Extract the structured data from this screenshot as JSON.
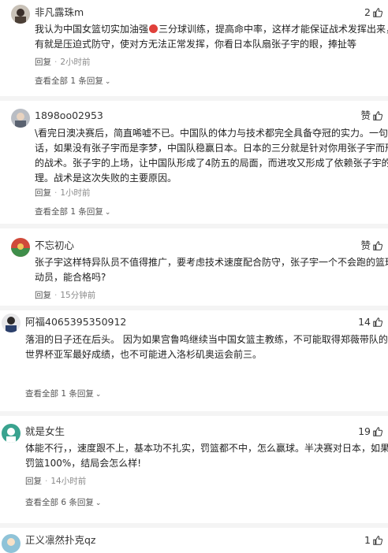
{
  "ui": {
    "reply_label": "回复",
    "dot": "·"
  },
  "comments": [
    {
      "username": "非凡露珠m",
      "likes": "2",
      "lines": [
        "我认为中国女篮切实加油强",
        "三分球训练，提高命中率，这样才能保证战术发挥出来，再",
        "有就是压迫式防守，使对方无法正常发挥，你看日本队扇张子宇的眼，捧扯等"
      ],
      "time": "2小时前",
      "view_replies": "查看全部 1 条回复"
    },
    {
      "username": "1898oo02953",
      "likes": "赞",
      "lines": [
        "\\看完日澳决赛后，简直唏嘘不已。中国队的体力与技术都完全具备夺冠的实力。一句",
        "话，如果没有张子宇而是李梦，中国队稳赢日本。日本的三分就是针对你用张子宇而形成",
        "的战术。张子宇的上场，让中国队形成了4防五的局面，而进攻又形成了依赖张子宇的心",
        "理。战术是这次失败的主要原因。"
      ],
      "time": "1小时前",
      "view_replies": "查看全部 1 条回复"
    },
    {
      "username": "不忘初心",
      "likes": "赞",
      "lines": [
        "张子宇这样特异队员不值得推广，要考虑技术速度配合防守，张子宇一个不会跑的篮球运",
        "动员，能合格吗?"
      ],
      "time": "15分钟前",
      "view_replies": ""
    },
    {
      "username": "阿福4065395350912",
      "likes": "14",
      "lines": [
        "落泪的日子还在后头。 因为如果宫鲁鸣继续当中国女篮主教练，不可能取得郑薇带队的",
        "世界杯亚军最好成绩，也不可能进入洛杉矶奥运会前三。"
      ],
      "time": "",
      "view_replies": "查看全部 1 条回复"
    },
    {
      "username": "就是女生",
      "likes": "19",
      "lines": [
        "体能不行，，速度跟不上，基本功不扎实，罚篮都不中，怎么赢球。半决赛对日本，如果",
        "罚篮100%，结局会怎么样!"
      ],
      "time": "14小时前",
      "view_replies": "查看全部 6 条回复"
    },
    {
      "username": "正义凛然扑克qz",
      "likes": "1",
      "lines": [],
      "time": "",
      "view_replies": ""
    }
  ],
  "colors": {
    "like_icon": "#333333",
    "meta": "#8a8a8a",
    "divider": "#f4f4f4"
  },
  "icons": [
    "thumbs-up-icon",
    "chevron-down-icon",
    "emoji-icon"
  ]
}
